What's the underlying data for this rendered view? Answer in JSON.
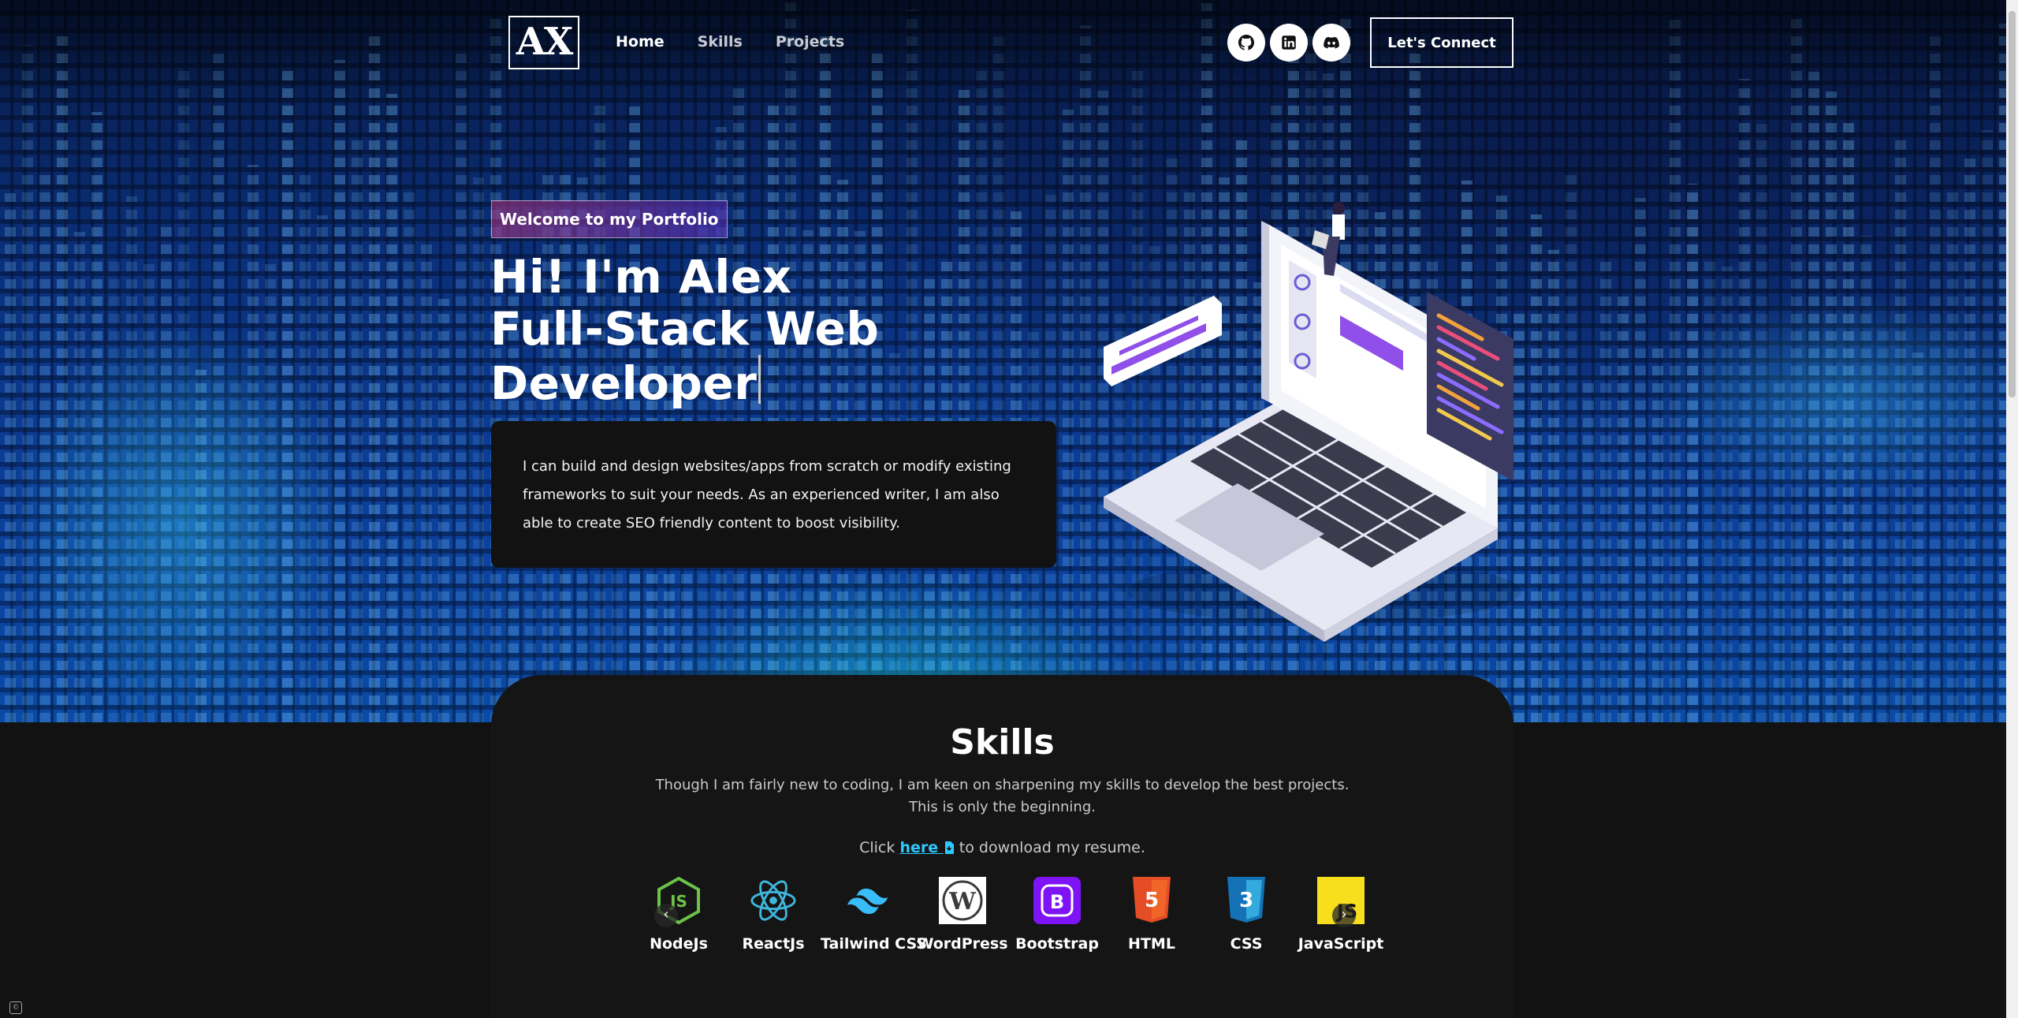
{
  "colors": {
    "hero_bg": "#0b3a94",
    "page_bg": "#121212",
    "accent_link": "#2ec8ff",
    "tagline_gradient_start": "#aa367c",
    "tagline_gradient_end": "#4a2fbd"
  },
  "nav": {
    "logo_text": "AX",
    "links": [
      {
        "label": "Home",
        "active": true
      },
      {
        "label": "Skills",
        "active": false
      },
      {
        "label": "Projects",
        "active": false
      }
    ],
    "social": [
      {
        "name": "github-icon"
      },
      {
        "name": "linkedin-icon"
      },
      {
        "name": "discord-icon"
      }
    ],
    "connect_label": "Let's Connect"
  },
  "hero": {
    "tagline": "Welcome to my Portfolio",
    "headline_line1": "Hi! I'm Alex",
    "headline_line2": "Full-Stack Web",
    "headline_line3": "Developer",
    "intro": "I can build and design websites/apps from scratch or modify existing frameworks to suit your needs. As an experienced writer, I am also able to create SEO friendly content to boost visibility."
  },
  "skills": {
    "title": "Skills",
    "description_line1": "Though I am fairly new to coding, I am keen on sharpening my skills to develop the best projects.",
    "description_line2": "This is only the beginning.",
    "resume_prefix": "Click",
    "resume_link": "here",
    "resume_suffix": "to download my resume.",
    "items": [
      {
        "label": "NodeJs",
        "icon": "nodejs-icon"
      },
      {
        "label": "ReactJs",
        "icon": "react-icon"
      },
      {
        "label": "Tailwind CSS",
        "icon": "tailwind-icon"
      },
      {
        "label": "WordPress",
        "icon": "wordpress-icon"
      },
      {
        "label": "Bootstrap",
        "icon": "bootstrap-icon"
      },
      {
        "label": "HTML",
        "icon": "html5-icon"
      },
      {
        "label": "CSS",
        "icon": "css3-icon"
      },
      {
        "label": "JavaScript",
        "icon": "javascript-icon"
      }
    ]
  }
}
